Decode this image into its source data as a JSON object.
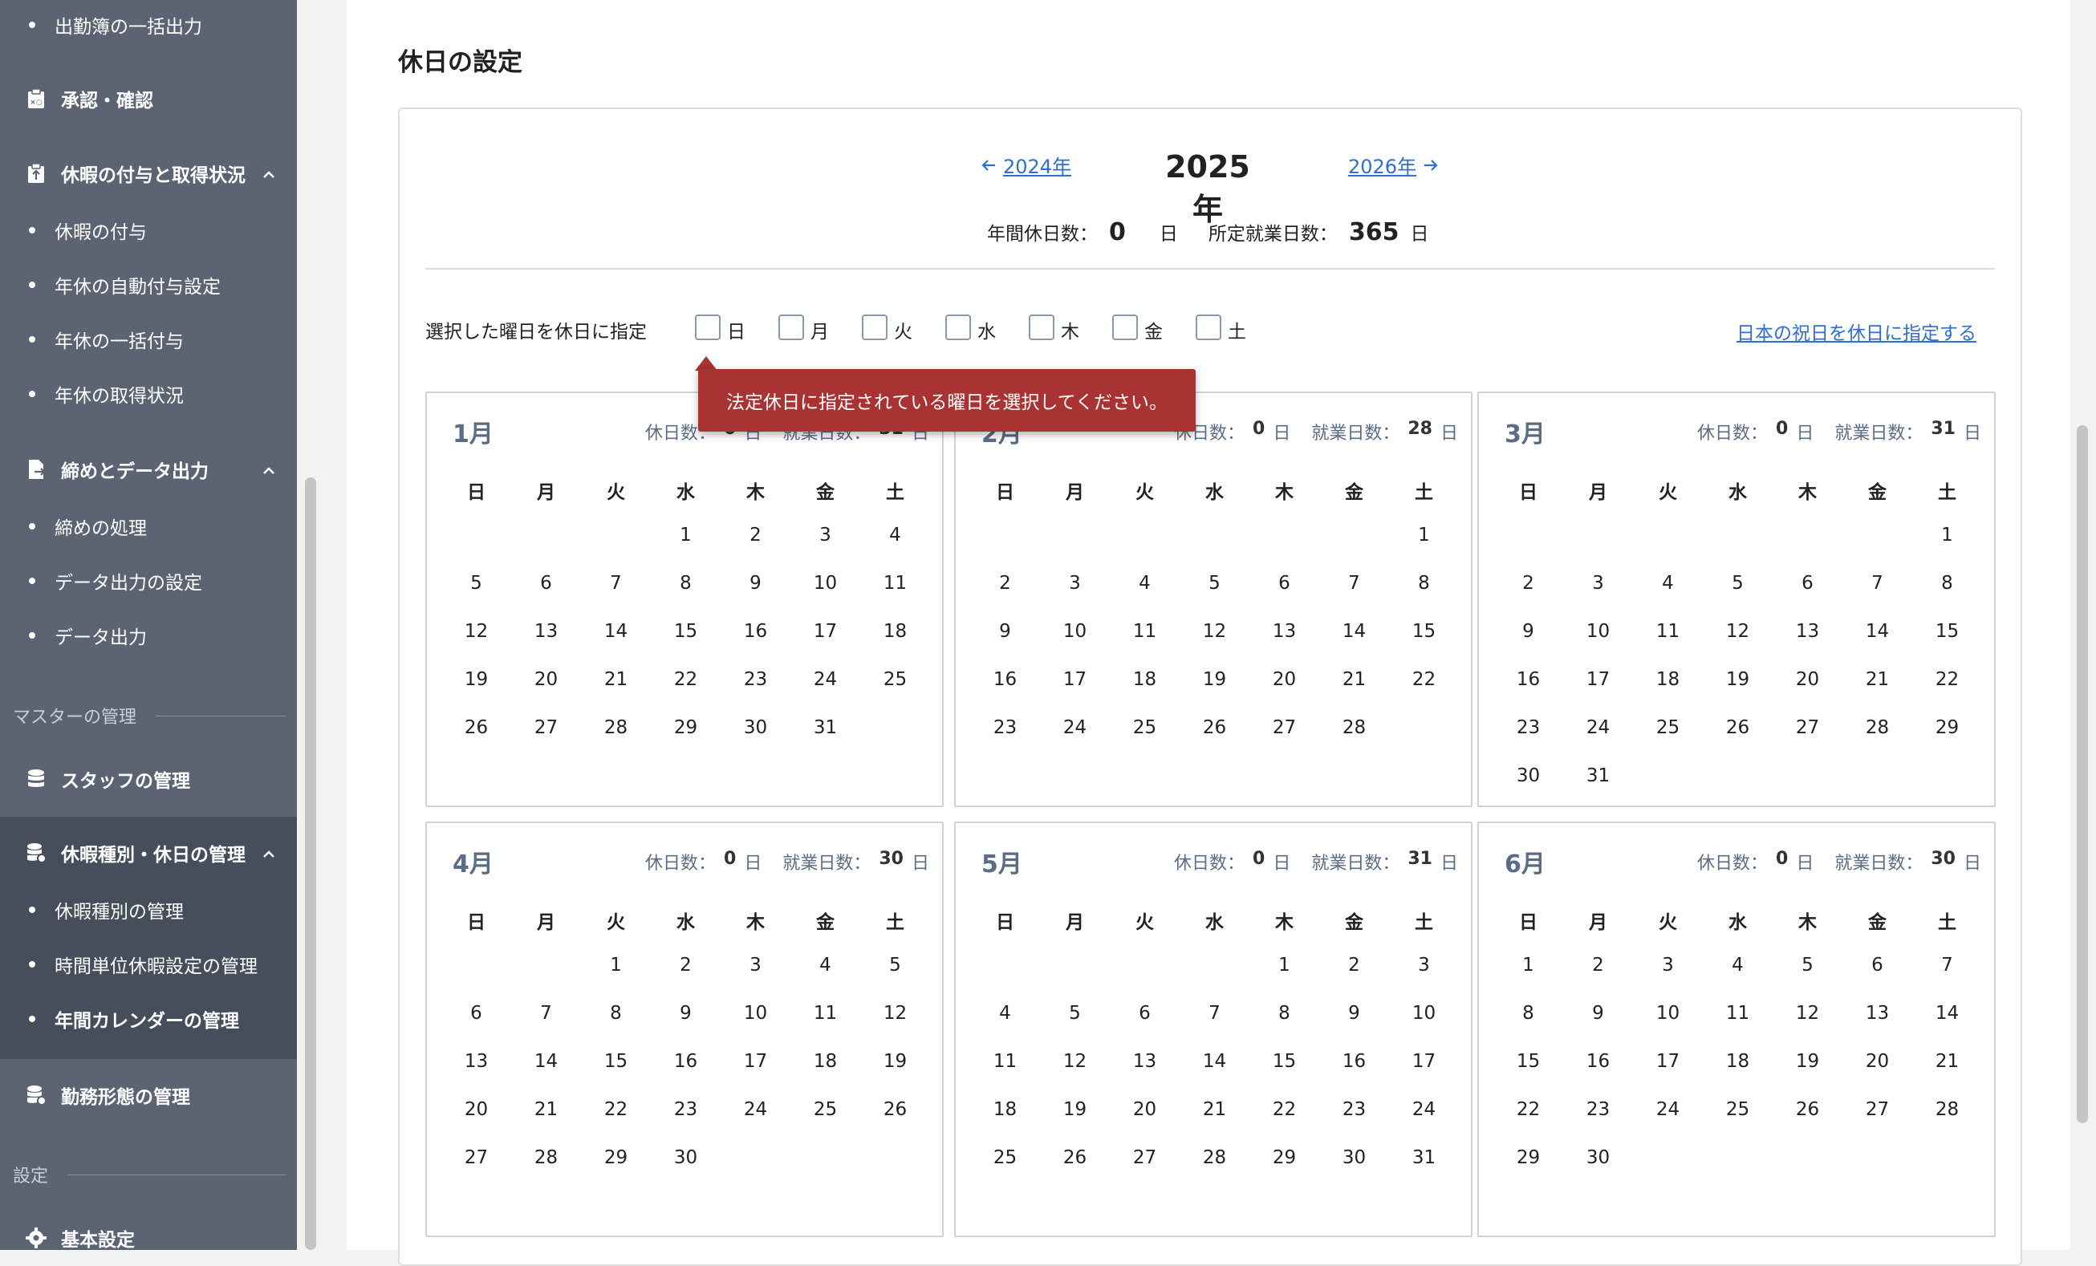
{
  "sidebar": {
    "top_sub": "出勤簿の一括出力",
    "approval": "承認・確認",
    "leave_grant": {
      "label": "休暇の付与と取得状況",
      "items": [
        "休暇の付与",
        "年休の自動付与設定",
        "年休の一括付与",
        "年休の取得状況"
      ]
    },
    "closing": {
      "label": "締めとデータ出力",
      "items": [
        "締めの処理",
        "データ出力の設定",
        "データ出力"
      ]
    },
    "master_section": "マスターの管理",
    "staff": "スタッフの管理",
    "leave_types": {
      "label": "休暇種別・休日の管理",
      "items": [
        "休暇種別の管理",
        "時間単位休暇設定の管理",
        "年間カレンダーの管理"
      ]
    },
    "work_pattern": "勤務形態の管理",
    "settings_section": "設定",
    "basic_settings": "基本設定"
  },
  "page": {
    "title": "休日の設定",
    "prev_year": "2024年",
    "current_year": "2025年",
    "next_year": "2026年",
    "annual_holidays_label": "年間休日数：",
    "annual_holidays_value": "0",
    "annual_holidays_unit": "日",
    "workdays_label": "所定就業日数：",
    "workdays_value": "365",
    "workdays_unit": "日",
    "weekday_select_label": "選択した曜日を休日に指定",
    "weekdays": [
      "日",
      "月",
      "火",
      "水",
      "木",
      "金",
      "土"
    ],
    "japan_holidays_link": "日本の祝日を休日に指定する",
    "tooltip": "法定休日に指定されている曜日を選択してください。"
  },
  "calendar": {
    "holiday_label": "休日数：",
    "workday_label": "就業日数：",
    "day_unit": "日",
    "months": [
      {
        "name": "1月",
        "holidays": "0",
        "workdays": "31",
        "start": 3,
        "days": 31
      },
      {
        "name": "2月",
        "holidays": "0",
        "workdays": "28",
        "start": 6,
        "days": 28
      },
      {
        "name": "3月",
        "holidays": "0",
        "workdays": "31",
        "start": 6,
        "days": 31
      },
      {
        "name": "4月",
        "holidays": "0",
        "workdays": "30",
        "start": 2,
        "days": 30
      },
      {
        "name": "5月",
        "holidays": "0",
        "workdays": "31",
        "start": 4,
        "days": 31
      },
      {
        "name": "6月",
        "holidays": "0",
        "workdays": "30",
        "start": 0,
        "days": 30
      }
    ]
  }
}
